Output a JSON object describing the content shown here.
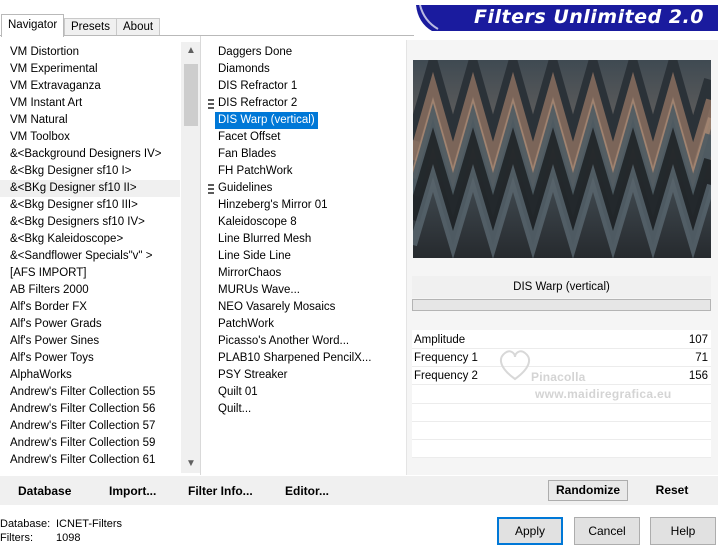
{
  "tabs": [
    "Navigator",
    "Presets",
    "About"
  ],
  "app_title": "Filters Unlimited 2.0",
  "categories": [
    "VM Distortion",
    "VM Experimental",
    "VM Extravaganza",
    "VM Instant Art",
    "VM Natural",
    "VM Toolbox",
    "&<Background Designers IV>",
    "&<Bkg Designer sf10 I>",
    "&<BKg Designer sf10 II>",
    "&<Bkg Designer sf10 III>",
    "&<Bkg Designers sf10 IV>",
    "&<Bkg Kaleidoscope>",
    "&<Sandflower Specials\"v\" >",
    "[AFS IMPORT]",
    "AB Filters 2000",
    "Alf's Border FX",
    "Alf's Power Grads",
    "Alf's Power Sines",
    "Alf's Power Toys",
    "AlphaWorks",
    "Andrew's Filter Collection 55",
    "Andrew's Filter Collection 56",
    "Andrew's Filter Collection 57",
    "Andrew's Filter Collection 59",
    "Andrew's Filter Collection 61"
  ],
  "selected_category": "&<BKg Designer sf10 II>",
  "filters": [
    "Daggers Done",
    "Diamonds",
    "DIS Refractor 1",
    "DIS Refractor 2",
    "DIS Warp (vertical)",
    "Facet Offset",
    "Fan Blades",
    "FH PatchWork",
    "Guidelines",
    "Hinzeberg's Mirror 01",
    "Kaleidoscope 8",
    "Line Blurred Mesh",
    "Line Side Line",
    "MirrorChaos",
    "MURUs Wave...",
    "NEO Vasarely Mosaics",
    "PatchWork",
    "Picasso's Another Word...",
    "PLAB10 Sharpened PencilX...",
    "PSY Streaker",
    "Quilt 01",
    "Quilt..."
  ],
  "selected_filter": "DIS Warp (vertical)",
  "filter_name": "DIS Warp (vertical)",
  "params": [
    {
      "label": "Amplitude",
      "value": "107"
    },
    {
      "label": "Frequency 1",
      "value": "71"
    },
    {
      "label": "Frequency 2",
      "value": "156"
    }
  ],
  "watermark": {
    "line1": "Pinacolla",
    "line2": "www.maidiregrafica.eu"
  },
  "toolbar": {
    "database": "Database",
    "import": "Import...",
    "filter_info": "Filter Info...",
    "editor": "Editor...",
    "randomize": "Randomize",
    "reset": "Reset"
  },
  "status": {
    "database_label": "Database:",
    "database_value": "ICNET-Filters",
    "filters_label": "Filters:",
    "filters_value": "1098"
  },
  "dialog": {
    "apply": "Apply",
    "cancel": "Cancel",
    "help": "Help"
  }
}
